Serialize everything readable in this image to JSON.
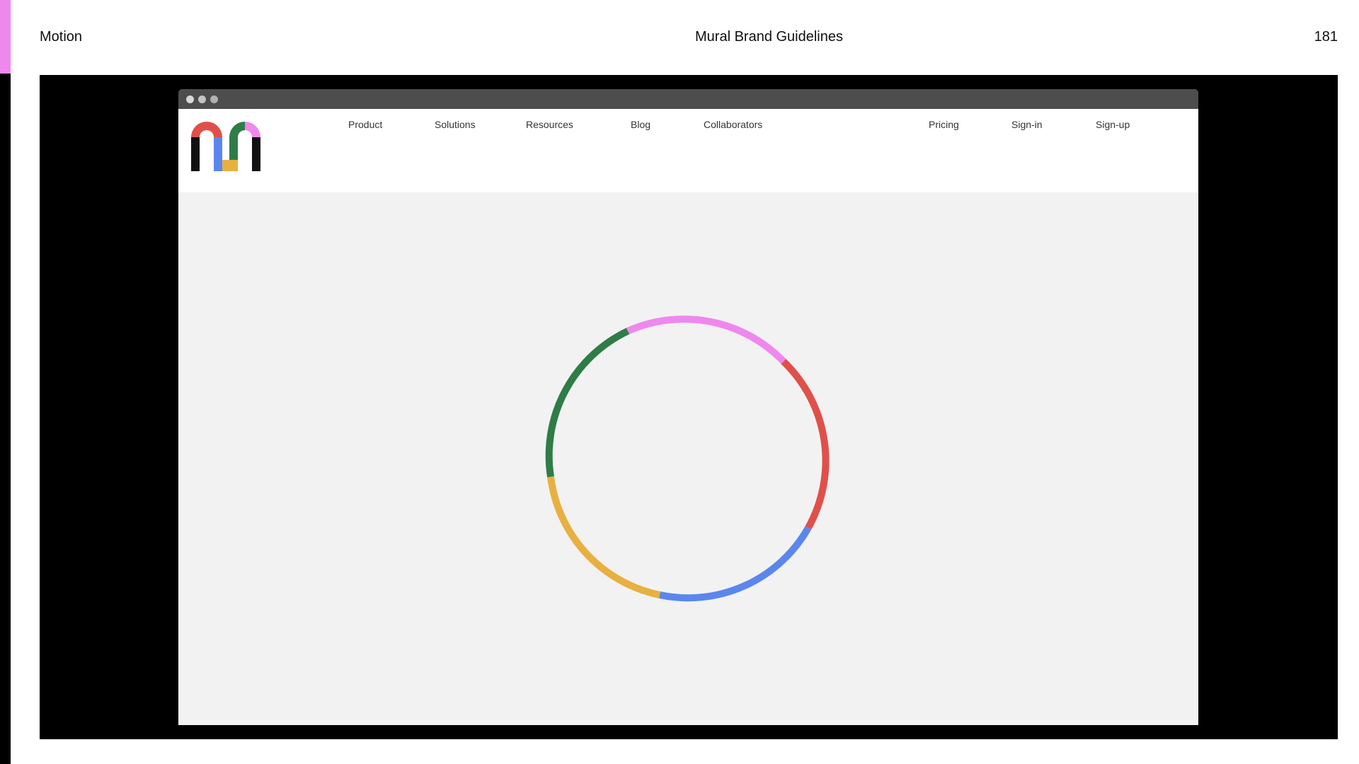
{
  "page": {
    "section": "Motion",
    "title": "Mural Brand Guidelines",
    "page_number": "181"
  },
  "browser": {
    "nav": {
      "left": [
        "Product",
        "Solutions",
        "Resources",
        "Blog",
        "Collaborators"
      ],
      "right": [
        "Pricing",
        "Sign-in",
        "Sign-up"
      ]
    },
    "logo_icon": "mural-m-logo-icon",
    "loader_icon": "loading-ring-icon"
  },
  "colors": {
    "accent_pink": "#ee88ee",
    "red": "#e0504a",
    "blue": "#5b86ee",
    "yellow": "#e8b040",
    "green": "#2e7d46",
    "pink": "#ee88ee"
  }
}
